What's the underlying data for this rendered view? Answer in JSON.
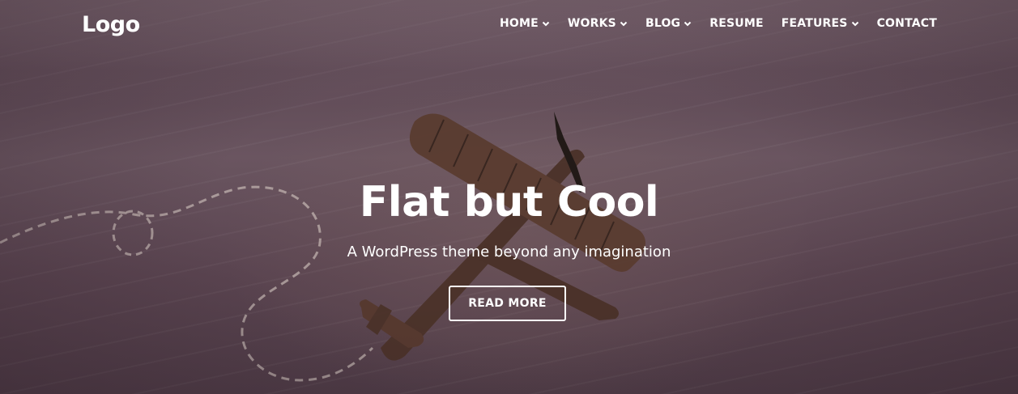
{
  "brand": {
    "logo_text": "Logo"
  },
  "nav": {
    "items": [
      {
        "label": "HOME",
        "has_dropdown": true
      },
      {
        "label": "WORKS",
        "has_dropdown": true
      },
      {
        "label": "BLOG",
        "has_dropdown": true
      },
      {
        "label": "RESUME",
        "has_dropdown": false
      },
      {
        "label": "FEATURES",
        "has_dropdown": true
      },
      {
        "label": "CONTACT",
        "has_dropdown": false
      }
    ]
  },
  "hero": {
    "title": "Flat but Cool",
    "subtitle": "A WordPress theme beyond any imagination",
    "button_label": "READ MORE",
    "background_subject": "wooden toy airplane on hardwood floor with dashed flight path",
    "overlay_color": "#5f4a56"
  },
  "icons": {
    "dropdown": "chevron-down-icon"
  }
}
